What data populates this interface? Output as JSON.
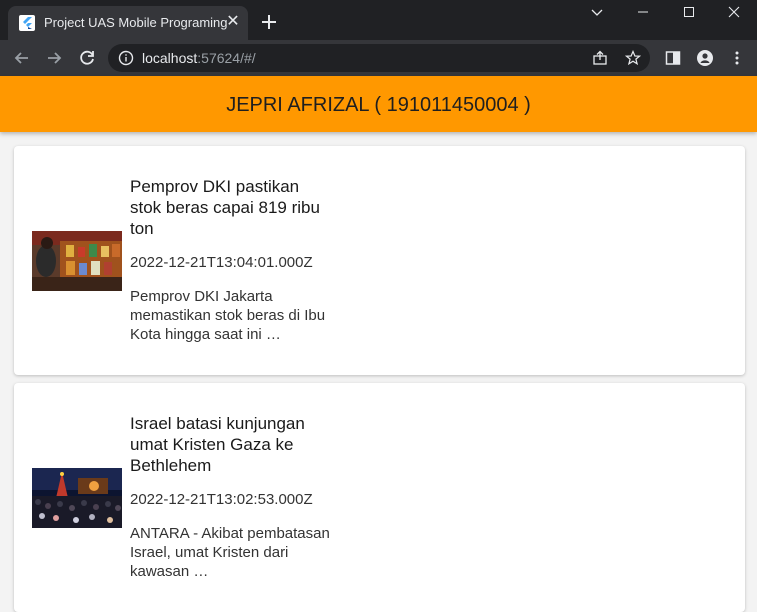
{
  "browser": {
    "tab_title": "Project UAS Mobile Programing",
    "url_host": "localhost",
    "url_rest": ":57624/#/"
  },
  "app": {
    "title": "JEPRI AFRIZAL ( 191011450004 )",
    "accent_color": "#ff9800"
  },
  "news": [
    {
      "title": "Pemprov DKI pastikan stok beras capai 819 ribu ton",
      "date": "2022-12-21T13:04:01.000Z",
      "description": "Pemprov DKI Jakarta memastikan stok beras di Ibu Kota hingga saat ini …"
    },
    {
      "title": "Israel batasi kunjungan umat Kristen Gaza ke Bethlehem",
      "date": "2022-12-21T13:02:53.000Z",
      "description": "ANTARA - Akibat pembatasan Israel, umat Kristen dari kawasan …"
    }
  ]
}
